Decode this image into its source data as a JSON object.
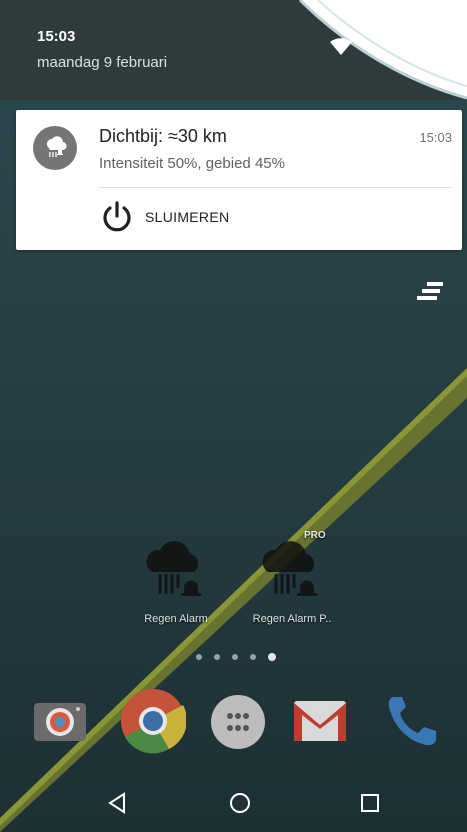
{
  "status": {
    "time": "15:03",
    "date": "maandag 9 februari"
  },
  "notification": {
    "title": "Dichtbij: ≈30 km",
    "time": "15:03",
    "text": "Intensiteit 50%, gebied 45%",
    "action_label": "SLUIMEREN"
  },
  "home": {
    "apps": [
      {
        "label": "Regen Alarm",
        "icon": "regen-alarm-icon"
      },
      {
        "label": "Regen Alarm P..",
        "icon": "regen-alarm-pro-icon",
        "badge": "PRO"
      }
    ],
    "page_dots": 5,
    "active_dot": 5,
    "dock": [
      "camera-icon",
      "chrome-icon",
      "app-drawer-icon",
      "gmail-icon",
      "phone-icon"
    ]
  },
  "navbar": [
    "back-icon",
    "home-icon",
    "recents-icon"
  ],
  "colors": {
    "accent": "#c8d13a",
    "wallpaper": "#2a4349"
  }
}
